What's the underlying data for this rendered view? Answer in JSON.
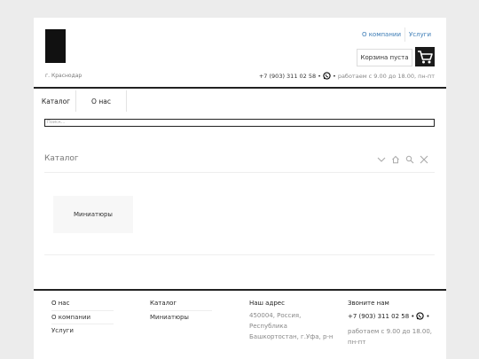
{
  "header": {
    "city": "г. Краснодар",
    "top_links": [
      "О компании",
      "Услуги"
    ],
    "cart_label": "Корзина пуста",
    "phone": "+7 (903) 311 02 58",
    "separator": "•",
    "hours": "работаем с 9.00 до 18.00, пн-пт"
  },
  "nav": {
    "items": [
      "Каталог",
      "О нас"
    ]
  },
  "search": {
    "placeholder": "Поиск..."
  },
  "section": {
    "title": "Каталог"
  },
  "catalog": {
    "categories": [
      "Миниатюры"
    ]
  },
  "footer": {
    "col1": {
      "title": "О нас",
      "links": [
        "О компании",
        "Услуги"
      ]
    },
    "col2": {
      "title": "Каталог",
      "links": [
        "Миниатюры"
      ]
    },
    "col3": {
      "title": "Наш адрес",
      "lines": [
        "450004, Россия,",
        "Республика",
        "Башкортостан, г.Уфа, р-н"
      ]
    },
    "col4": {
      "title": "Звоните нам",
      "phone": "+7 (903) 311 02 58",
      "separator": "•",
      "hours": "работаем с 9.00 до 18.00, пн-пт"
    }
  },
  "colors": {
    "link": "#3a7bb5",
    "dark": "#222222"
  }
}
